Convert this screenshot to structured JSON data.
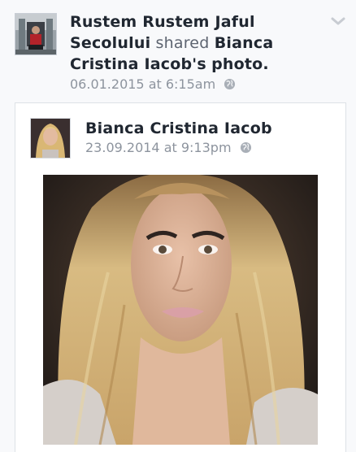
{
  "post": {
    "author": "Rustem Rustem Jaful Secolului",
    "action": "shared",
    "target_owner": "Bianca Cristina Iacob's",
    "target_type": "photo.",
    "timestamp": "06.01.2015 at 6:15am",
    "privacy_icon": "globe-icon",
    "menu_icon": "chevron-down-icon"
  },
  "shared": {
    "author": "Bianca Cristina Iacob",
    "timestamp": "23.09.2014 at 9:13pm",
    "privacy_icon": "globe-icon"
  },
  "colors": {
    "name": "#202731",
    "meta": "#8d949e",
    "card_border": "#dde1e6"
  }
}
